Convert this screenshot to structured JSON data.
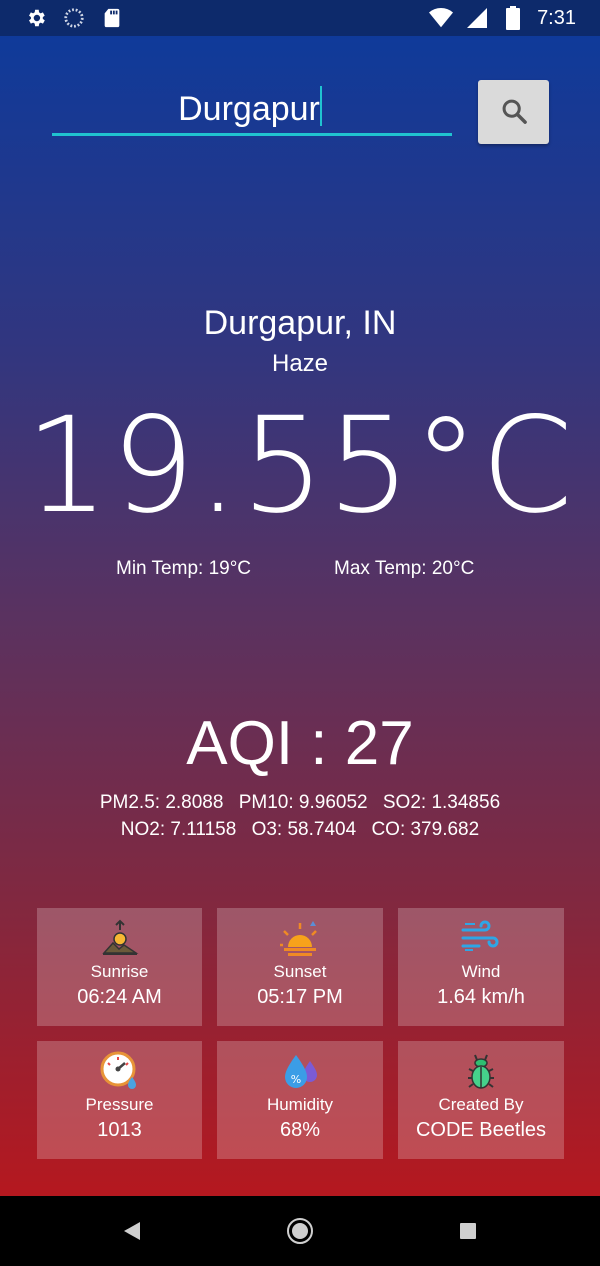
{
  "status_bar": {
    "time": "7:31",
    "icons": [
      "settings-icon",
      "loading-icon",
      "sd-card-icon",
      "wifi-icon",
      "signal-icon",
      "battery-icon"
    ]
  },
  "search": {
    "value": "Durgapur",
    "button_icon": "search-icon",
    "accent_color": "#20c3d0"
  },
  "weather": {
    "city": "Durgapur, IN",
    "condition": "Haze",
    "temperature": "19.55°C",
    "min_temp": "Min Temp: 19°C",
    "max_temp": "Max Temp: 20°C"
  },
  "air_quality": {
    "aqi": "AQI : 27",
    "pm25": "PM2.5: 2.8088",
    "pm10": "PM10: 9.96052",
    "so2": "SO2: 1.34856",
    "no2": "NO2: 7.11158",
    "o3": "O3: 58.7404",
    "co": "CO: 379.682"
  },
  "tiles": [
    {
      "label": "Sunrise",
      "value": "06:24 AM",
      "icon": "sunrise-icon"
    },
    {
      "label": "Sunset",
      "value": "05:17 PM",
      "icon": "sunset-icon"
    },
    {
      "label": "Wind",
      "value": "1.64 km/h",
      "icon": "wind-icon"
    },
    {
      "label": "Pressure",
      "value": "1013",
      "icon": "pressure-gauge-icon"
    },
    {
      "label": "Humidity",
      "value": "68%",
      "icon": "humidity-drop-icon"
    },
    {
      "label": "Created By",
      "value": "CODE Beetles",
      "icon": "beetle-icon"
    }
  ],
  "nav": [
    "back-icon",
    "home-icon",
    "recents-icon"
  ],
  "colors": {
    "gradient_top": "#0f3a9a",
    "gradient_bottom": "#b5181f",
    "tile_bg": "rgba(255,255,255,0.22)"
  }
}
